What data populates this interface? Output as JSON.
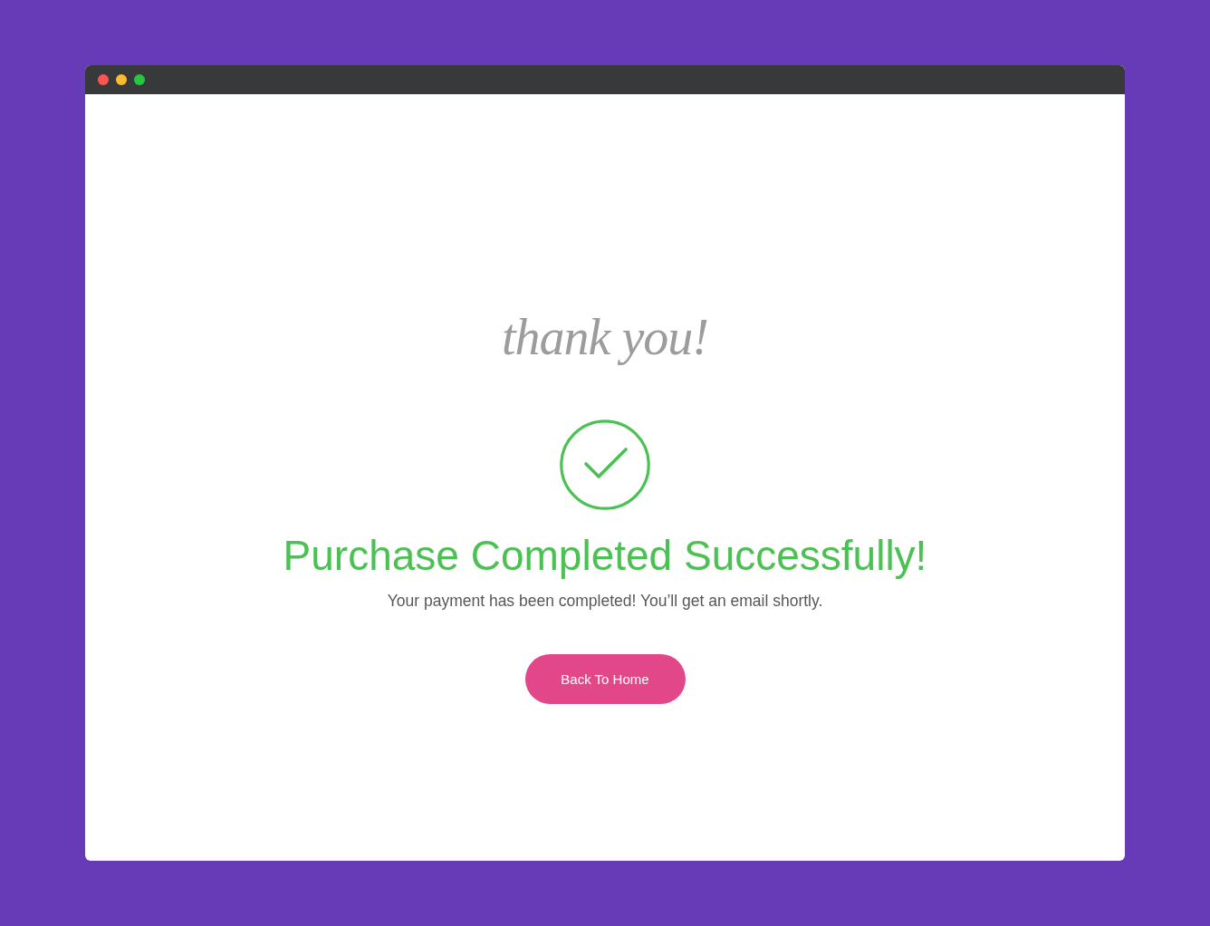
{
  "window": {
    "controls": [
      {
        "color": "#fd5652"
      },
      {
        "color": "#fdbb2e"
      },
      {
        "color": "#26c83f"
      }
    ]
  },
  "greeting": "thank you!",
  "heading": "Purchase Completed Successfully!",
  "message": "Your payment has been completed! You’ll get an email shortly.",
  "button": {
    "label": "Back To Home"
  }
}
